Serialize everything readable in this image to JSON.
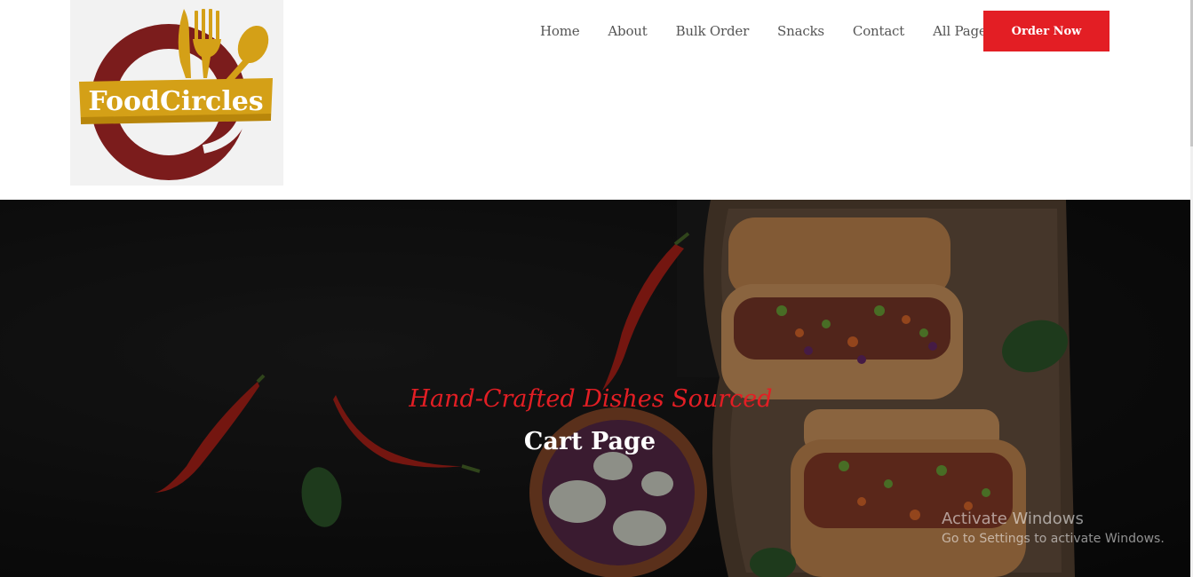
{
  "brand": {
    "logo_text": "FoodCircles",
    "colors": {
      "maroon": "#7b1c1c",
      "gold": "#d4a017",
      "accent_red": "#e31e24"
    }
  },
  "nav": {
    "items": [
      {
        "label": "Home"
      },
      {
        "label": "About"
      },
      {
        "label": "Bulk Order"
      },
      {
        "label": "Snacks"
      },
      {
        "label": "Contact"
      },
      {
        "label": "All Pages"
      }
    ],
    "cta_label": "Order Now"
  },
  "hero": {
    "tagline": "Hand-Crafted Dishes Sourced",
    "title": "Cart Page"
  },
  "watermark": {
    "line1": "Activate Windows",
    "line2": "Go to Settings to activate Windows."
  }
}
